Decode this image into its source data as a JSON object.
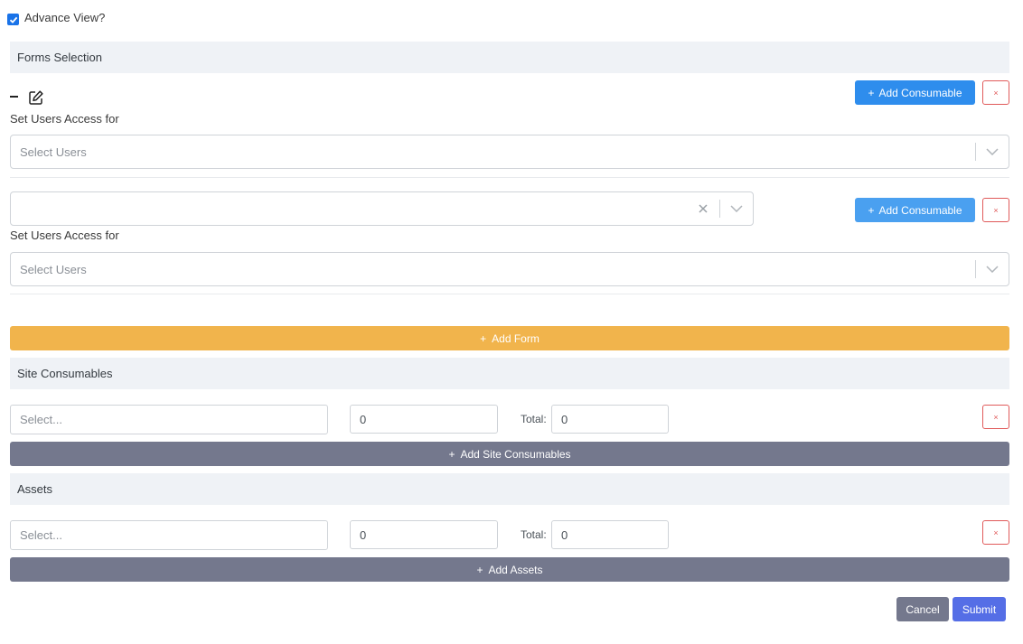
{
  "advance_view": {
    "label": "Advance View?",
    "checked": true
  },
  "forms_section": {
    "title": "Forms Selection",
    "rows": [
      {
        "add_consumable_label": "Add Consumable",
        "remove_label": "×",
        "access_label": "Set Users Access for",
        "users_placeholder": "Select Users"
      },
      {
        "form_select_value": "",
        "add_consumable_label": "Add Consumable",
        "remove_label": "×",
        "access_label": "Set Users Access for",
        "users_placeholder": "Select Users"
      }
    ],
    "add_form_label": "Add Form"
  },
  "site_consumables": {
    "title": "Site Consumables",
    "select_placeholder": "Select...",
    "quantity": "0",
    "total_label": "Total:",
    "total_value": "0",
    "remove_label": "×",
    "add_label": "Add Site Consumables"
  },
  "assets": {
    "title": "Assets",
    "select_placeholder": "Select...",
    "quantity": "0",
    "total_label": "Total:",
    "total_value": "0",
    "remove_label": "×",
    "add_label": "Add Assets"
  },
  "footer": {
    "cancel_label": "Cancel",
    "submit_label": "Submit"
  },
  "icons": {
    "plus": "+",
    "minus": "minus-icon",
    "edit": "edit-icon",
    "chevron": "chevron-down-icon",
    "clear": "clear-icon"
  }
}
